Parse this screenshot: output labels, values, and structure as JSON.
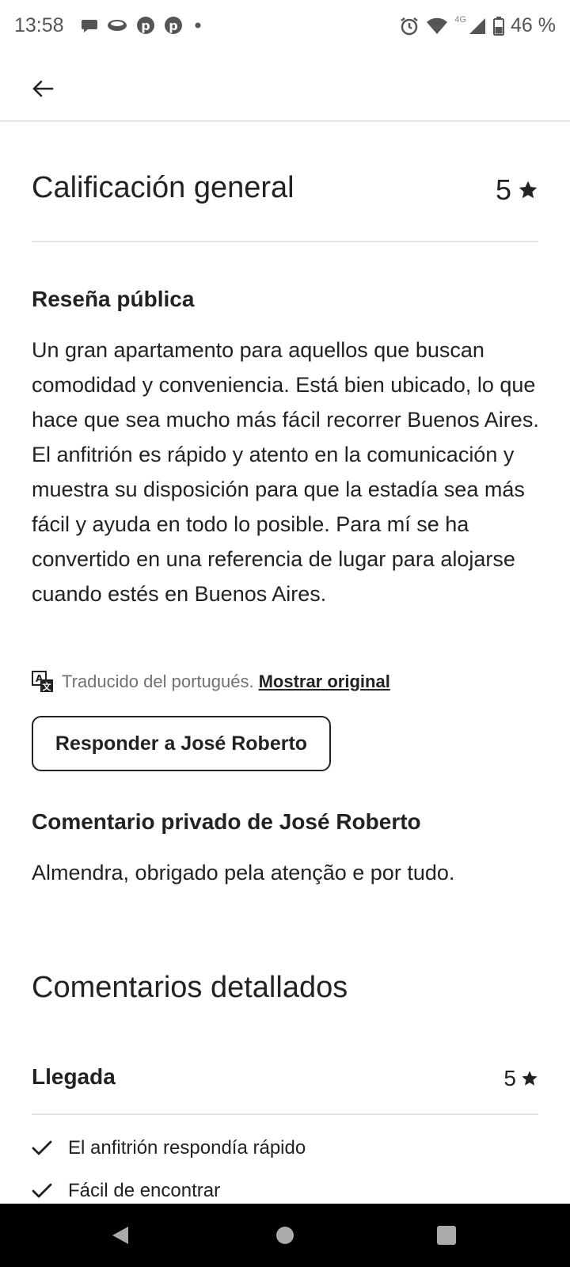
{
  "status_bar": {
    "time": "13:58",
    "network": "4G",
    "battery": "46 %",
    "notification_icons": [
      "chat-bubble-icon",
      "cloud-icon",
      "pinterest-icon",
      "pinterest-icon",
      "dot-icon"
    ]
  },
  "overall": {
    "title": "Calificación general",
    "score": "5"
  },
  "public_review": {
    "heading": "Reseña pública",
    "text": "Un gran apartamento para aquellos que buscan comodidad y conveniencia. Está bien ubicado, lo que hace que sea mucho más fácil recorrer Buenos Aires. El anfitrión es rápido y atento en la comunicación y muestra su disposición para que la estadía sea más fácil y ayuda en todo lo posible. Para mí se ha convertido en una referencia de lugar para alojarse cuando estés en Buenos Aires.",
    "translation_note": "Traducido del portugués.",
    "show_original": "Mostrar original",
    "reply_button": "Responder a José Roberto"
  },
  "private_comment": {
    "heading": "Comentario privado de José Roberto",
    "text": "Almendra, obrigado pela atenção e por tudo."
  },
  "detailed": {
    "title": "Comentarios detallados",
    "categories": [
      {
        "name": "Llegada",
        "score": "5",
        "checks": [
          "El anfitrión respondía rápido",
          "Fácil de encontrar"
        ]
      }
    ]
  },
  "colors": {
    "text": "#222222",
    "muted": "#717171",
    "divider": "#e4e4e4",
    "nav_bar": "#000000"
  }
}
